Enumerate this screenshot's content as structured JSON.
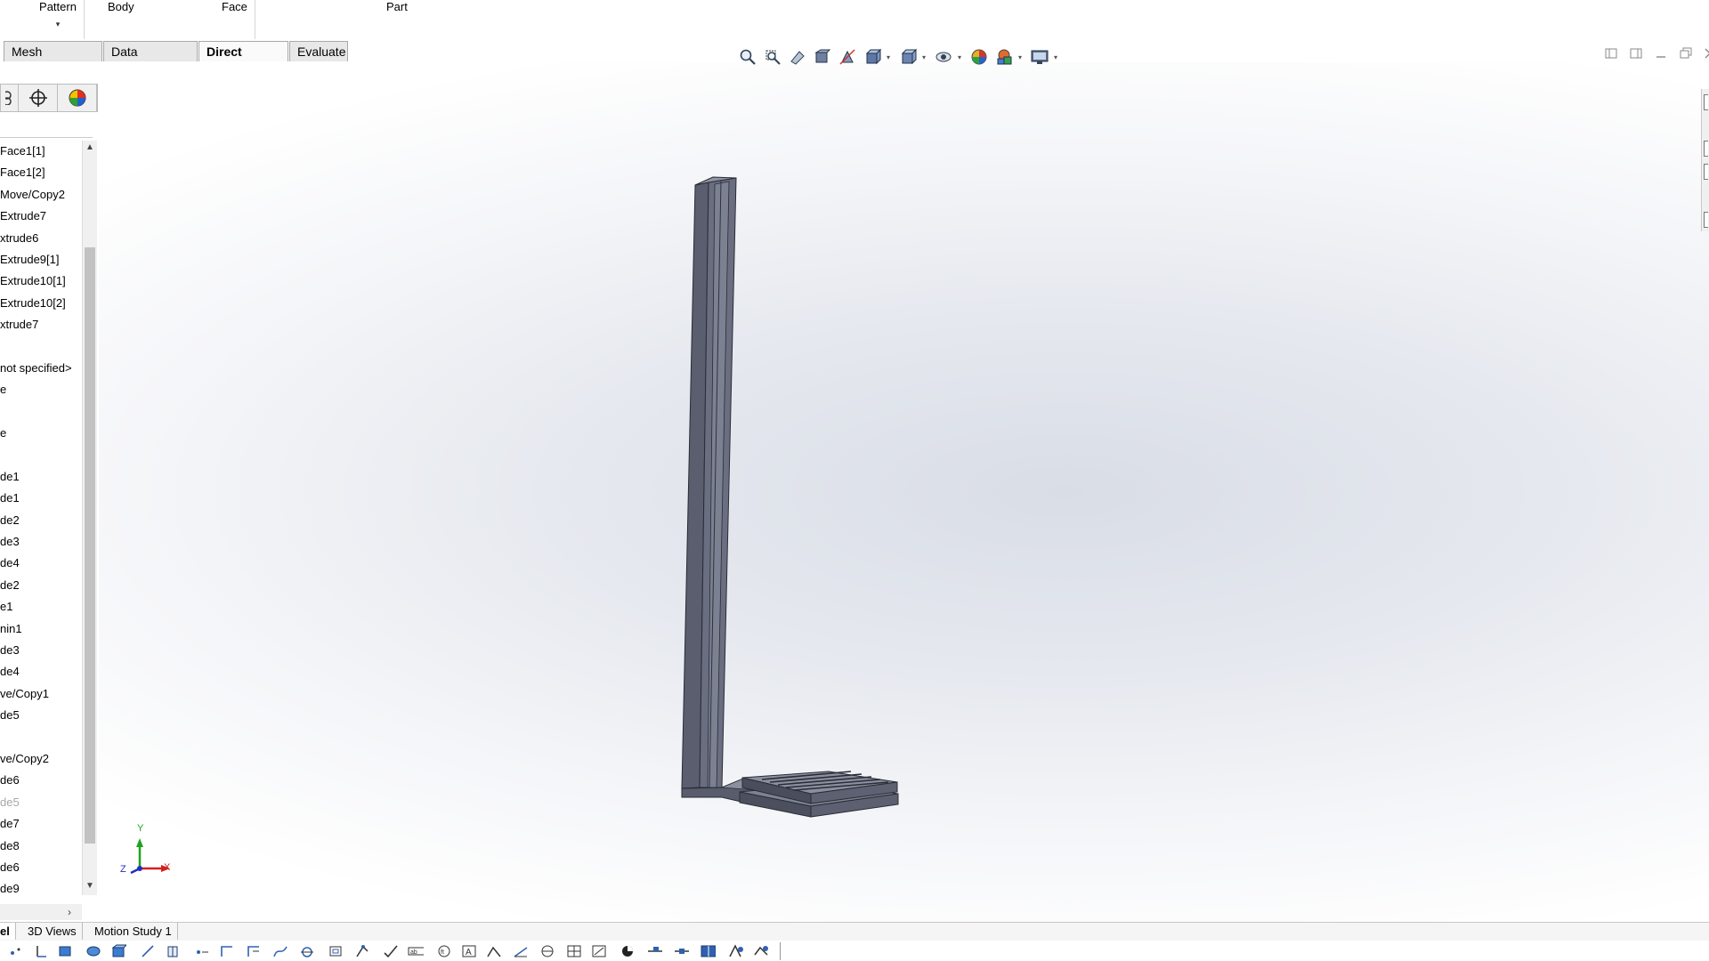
{
  "ribbon": {
    "pattern_label": "Pattern",
    "body_label": "Body",
    "face_label": "Face",
    "part_label": "Part"
  },
  "tabs": [
    {
      "label": "Mesh Modeling"
    },
    {
      "label": "Data Migration"
    },
    {
      "label": "Direct Editing",
      "active": true
    },
    {
      "label": "Evaluate"
    }
  ],
  "tree": {
    "items": [
      "Face1[1]",
      "Face1[2]",
      "Move/Copy2",
      "Extrude7",
      "xtrude6",
      "Extrude9[1]",
      "Extrude10[1]",
      "Extrude10[2]",
      "xtrude7",
      "",
      "not specified>",
      "e",
      "",
      "e",
      "",
      "de1",
      "de1",
      "de2",
      "de3",
      "de4",
      "de2",
      "e1",
      "nin1",
      "de3",
      "de4",
      "ve/Copy1",
      "de5",
      "",
      "ve/Copy2",
      "de6",
      "de5",
      "de7",
      "de8",
      "de6",
      "de9"
    ]
  },
  "bottom_tabs": [
    {
      "label": "el",
      "active": true
    },
    {
      "label": "3D Views"
    },
    {
      "label": "Motion Study 1"
    }
  ],
  "triad": {
    "x": "X",
    "y": "Y",
    "z": "Z"
  },
  "colors": {
    "model": "#5c6070",
    "model_dark": "#3f4250",
    "model_light": "#8a8fa0",
    "axis_x": "#d02020",
    "axis_y": "#20a020",
    "axis_z": "#2030c0"
  }
}
